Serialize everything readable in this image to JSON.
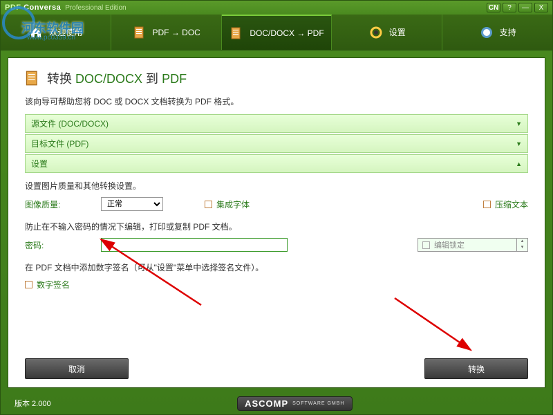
{
  "title": {
    "brand_prefix": "PDF",
    "brand_suffix": "Conversa",
    "edition": "Professional Edition",
    "lang": "CN"
  },
  "tabs": [
    {
      "label": "欢迎使用",
      "icon": "home"
    },
    {
      "label": "PDF → DOC",
      "icon": "doc"
    },
    {
      "label": "DOC/DOCX → PDF",
      "icon": "doc",
      "active": true
    },
    {
      "label": "设置",
      "icon": "gear"
    },
    {
      "label": "支持",
      "icon": "help"
    }
  ],
  "page": {
    "title_prefix": "转换",
    "title_mid": "DOC/DOCX",
    "title_to": "到",
    "title_suffix": "PDF",
    "subtitle": "该向导可帮助您将 DOC 或 DOCX 文档转换为 PDF 格式。"
  },
  "accordion": {
    "source": "源文件 (DOC/DOCX)",
    "target": "目标文件 (PDF)",
    "settings": "设置"
  },
  "settings": {
    "desc": "设置图片质量和其他转换设置。",
    "quality_label": "图像质量:",
    "quality_value": "正常",
    "embed_font": "集成字体",
    "compress": "压缩文本",
    "protect_desc": "防止在不输入密码的情况下编辑，打印或复制 PDF 文档。",
    "password_label": "密码:",
    "password_value": "",
    "edit_lock": "编辑锁定",
    "signature_desc": "在 PDF 文档中添加数字签名（可从\"设置\"菜单中选择签名文件）。",
    "digital_sig": "数字签名"
  },
  "buttons": {
    "cancel": "取消",
    "convert": "转换"
  },
  "footer": {
    "version": "版本 2.000",
    "company": "ASCOMP",
    "tagline": "SOFTWARE GMBH"
  },
  "watermark": {
    "text": "河东软件园",
    "url": "www.pc0359.cn"
  }
}
